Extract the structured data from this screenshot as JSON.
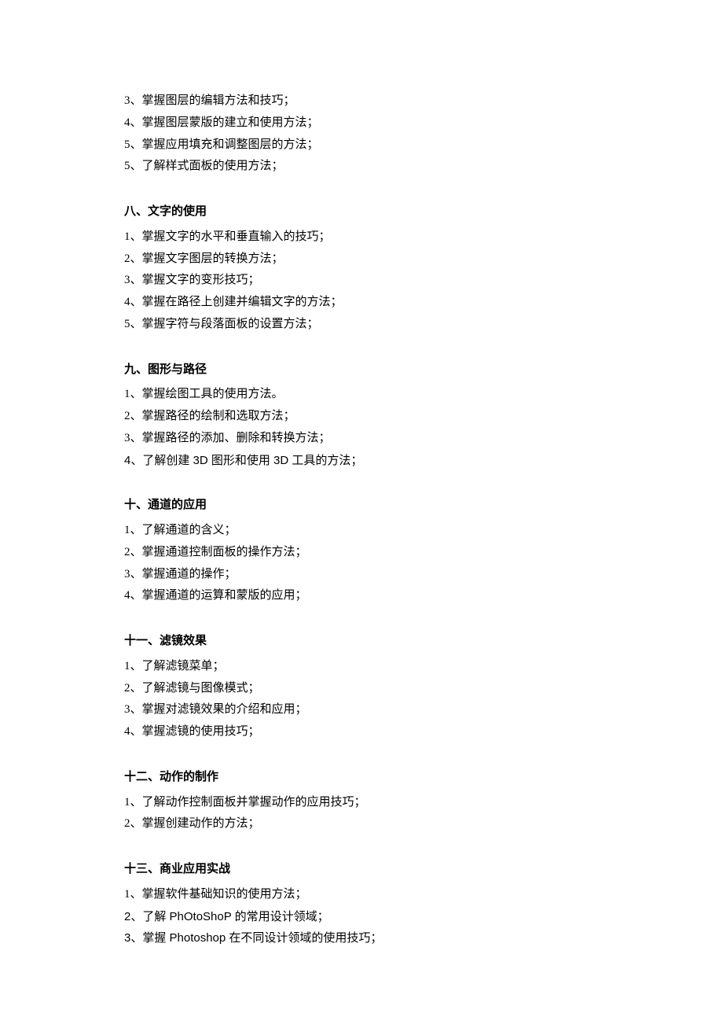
{
  "intro_items": [
    "3、掌握图层的编辑方法和技巧；",
    "4、掌握图层蒙版的建立和使用方法；",
    "5、掌握应用填充和调整图层的方法；",
    "5、了解样式面板的使用方法；"
  ],
  "sections": [
    {
      "heading": "八、文字的使用",
      "items": [
        "1、掌握文字的水平和垂直输入的技巧；",
        "2、掌握文字图层的转换方法；",
        "3、掌握文字的变形技巧；",
        "4、掌握在路径上创建并编辑文字的方法；",
        "5、掌握字符与段落面板的设置方法；"
      ]
    },
    {
      "heading": "九、图形与路径",
      "items": [
        "1、掌握绘图工具的使用方法。",
        "2、掌握路径的绘制和选取方法；",
        "3、掌握路径的添加、删除和转换方法；",
        "4、了解创建 3D 图形和使用 3D 工具的方法；"
      ]
    },
    {
      "heading": "十、通道的应用",
      "items": [
        "1、了解通道的含义；",
        "2、掌握通道控制面板的操作方法；",
        "3、掌握通道的操作；",
        "4、掌握通道的运算和蒙版的应用；"
      ]
    },
    {
      "heading": "十一、滤镜效果",
      "items": [
        "1、了解滤镜菜单；",
        "2、了解滤镜与图像模式；",
        "3、掌握对滤镜效果的介绍和应用；",
        "4、掌握滤镜的使用技巧；"
      ]
    },
    {
      "heading": "十二、动作的制作",
      "items": [
        "1、了解动作控制面板并掌握动作的应用技巧；",
        "2、掌握创建动作的方法；"
      ]
    },
    {
      "heading": "十三、商业应用实战",
      "items": [
        "1、掌握软件基础知识的使用方法；",
        "2、了解 PhOtoShoP 的常用设计领域；",
        "3、掌握 Photoshop 在不同设计领域的使用技巧；"
      ]
    }
  ]
}
